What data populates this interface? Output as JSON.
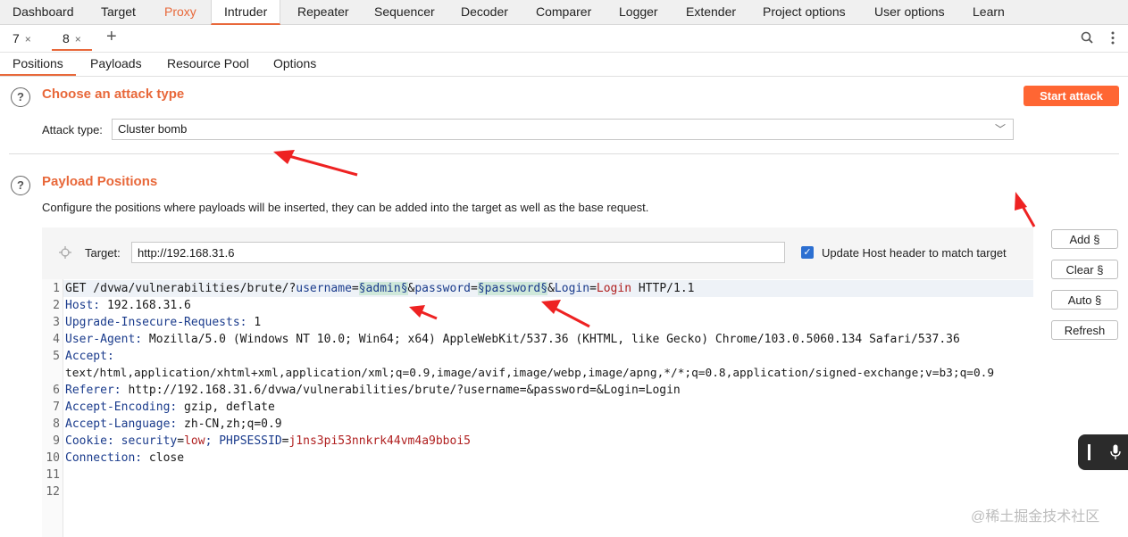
{
  "top_tabs": [
    "Dashboard",
    "Target",
    "Proxy",
    "Intruder",
    "Repeater",
    "Sequencer",
    "Decoder",
    "Comparer",
    "Logger",
    "Extender",
    "Project options",
    "User options",
    "Learn"
  ],
  "request_tabs": [
    {
      "label": "7",
      "close": "×"
    },
    {
      "label": "8",
      "close": "×"
    }
  ],
  "add_tab": "+",
  "sub_tabs": [
    "Positions",
    "Payloads",
    "Resource Pool",
    "Options"
  ],
  "attack": {
    "help": "?",
    "title": "Choose an attack type",
    "label": "Attack type:",
    "value": "Cluster bomb",
    "chevron": "﹀",
    "start_button": "Start attack"
  },
  "positions": {
    "help": "?",
    "title": "Payload Positions",
    "description": "Configure the positions where payloads will be inserted, they can be added into the target as well as the base request.",
    "target_label": "Target:",
    "target_value": "http://192.168.31.6",
    "update_host_label": "Update Host header to match target",
    "check": "✓",
    "buttons": {
      "add": "Add §",
      "clear": "Clear §",
      "auto": "Auto §",
      "refresh": "Refresh"
    }
  },
  "request": {
    "line_numbers": [
      "1",
      "2",
      "3",
      "4",
      "5",
      "6",
      "7",
      "8",
      "9",
      "10",
      "11",
      "12"
    ],
    "l1": {
      "a": "GET /dvwa/vulnerabilities/brute/?",
      "b": "username",
      "c": "=",
      "d": "§admin§",
      "e": "&",
      "f": "password",
      "g": "=",
      "h": "§password§",
      "i": "&",
      "j": "Login",
      "k": "=",
      "l": "Login",
      "m": " HTTP/1.1"
    },
    "l2": {
      "k": "Host:",
      "v": " 192.168.31.6"
    },
    "l3": {
      "k": "Upgrade-Insecure-Requests:",
      "v": " 1"
    },
    "l4": {
      "k": "User-Agent:",
      "v": " Mozilla/5.0 (Windows NT 10.0; Win64; x64) AppleWebKit/537.36 (KHTML, like Gecko) Chrome/103.0.5060.134 Safari/537.36"
    },
    "l5": {
      "k": "Accept:",
      "v": "text/html,application/xhtml+xml,application/xml;q=0.9,image/avif,image/webp,image/apng,*/*;q=0.8,application/signed-exchange;v=b3;q=0.9"
    },
    "l6": {
      "k": "Referer:",
      "v": " http://192.168.31.6/dvwa/vulnerabilities/brute/?username=&password=&Login=Login"
    },
    "l7": {
      "k": "Accept-Encoding:",
      "v": " gzip, deflate"
    },
    "l8": {
      "k": "Accept-Language:",
      "v": " zh-CN,zh;q=0.9"
    },
    "l9": {
      "k": "Cookie:",
      "a": " security",
      "b": "=",
      "c": "low",
      "d": "; PHPSESSID",
      "e": "=",
      "f": "j1ns3pi53nnkrk44vm4a9bboi5"
    },
    "l10": {
      "k": "Connection:",
      "v": " close"
    }
  },
  "watermark": "@稀土掘金技术社区",
  "colors": {
    "accent": "#e8683a",
    "start_button": "#ff6633",
    "arrow": "#ee2222",
    "checkbox": "#2c6fd1"
  },
  "icons": {
    "search": "search-icon",
    "more": "more-vertical-icon",
    "crosshair": "crosshair-icon",
    "mic": "mic-icon"
  }
}
